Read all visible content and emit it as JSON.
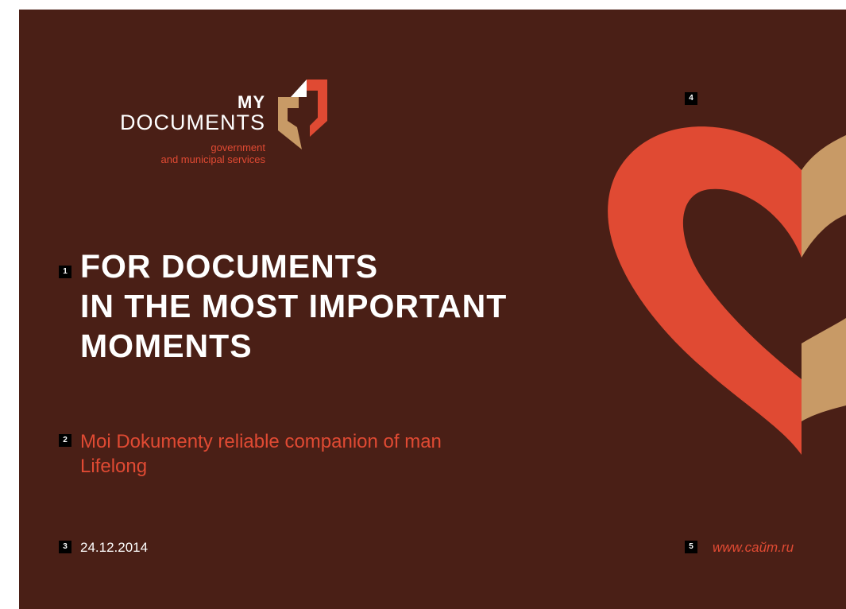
{
  "logo": {
    "line1": "MY",
    "line2": "DOCUMENTS",
    "sub1": "government",
    "sub2": "and municipal services"
  },
  "markers": [
    "1",
    "2",
    "3",
    "4",
    "5"
  ],
  "headline": [
    "FOR DOCUMENTS",
    "IN THE MOST IMPORTANT",
    "MOMENTS"
  ],
  "subtitle": [
    "Moi Dokumenty reliable companion of man",
    "Lifelong"
  ],
  "date": "24.12.2014",
  "website": "www.caйm.ru",
  "colors": {
    "background": "#4a1f16",
    "accent_red": "#e04a33",
    "accent_tan": "#c89a66",
    "text_white": "#ffffff"
  }
}
